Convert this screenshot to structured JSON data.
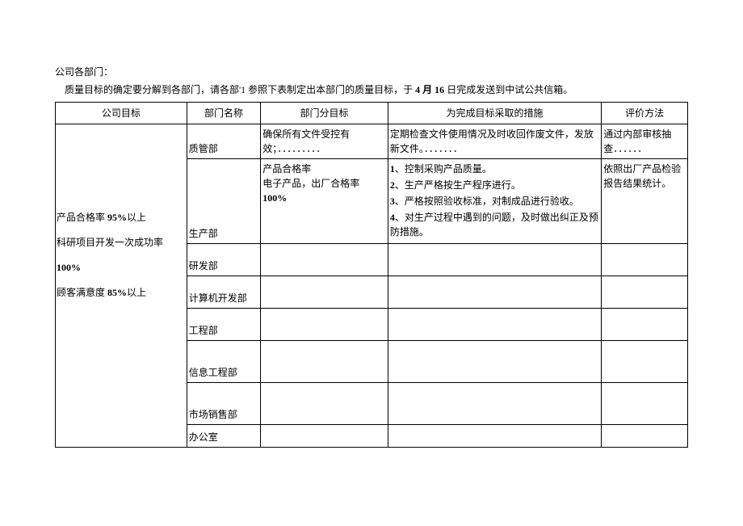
{
  "intro": {
    "line1": "公司各部门：",
    "line2_prefix": "质量目标的确定要分解到各部门，请各部'1 参照下表制定出本部门的质量目标，于 ",
    "line2_bold": "4 月 16",
    "line2_suffix": " 日完成发送到中试公共信箱。"
  },
  "headers": {
    "h1": "公司目标",
    "h2": "部门名称",
    "h3": "部门分目标",
    "h4": "为完成目标采取的措施",
    "h5": "评价方法"
  },
  "company_goals": {
    "g1_pre": "产品合格率 ",
    "g1_bold": "95%",
    "g1_post": "以上",
    "g2_pre": "科研项目开发一次成功率 ",
    "g2_bold": "100%",
    "g3_pre": "顾客满意度 ",
    "g3_bold": "85%",
    "g3_post": "以上"
  },
  "rows": {
    "r1": {
      "dept": "质管部",
      "sub": "确保所有文件受控有效；．．．．．．．．．",
      "measure": "定期检查文件使用情况及时收回作废文件，发放新文件。．．．．．．．",
      "eval": "通过内部审核抽查．．．．．．"
    },
    "r2": {
      "dept": "生产部",
      "sub_l1": "产品合格率",
      "sub_l2_pre": "电子产品，出厂合格率 ",
      "sub_l2_bold": "100%",
      "m1_pre": "1",
      "m1": "、控制采购产品质量。",
      "m2_pre": "2",
      "m2": "、生产严格按生产程序进行。",
      "m3_pre": "3",
      "m3": "、严格按照验收标准，对制成品进行验收。",
      "m4_pre": "4",
      "m4": "、对生产过程中遇到的问题，及时做出纠正及预防措施。",
      "eval": "依照出厂产品检验报告结果统计。"
    },
    "r3": {
      "dept": "研发部"
    },
    "r4": {
      "dept": "计算机开发部"
    },
    "r5": {
      "dept": "工程部"
    },
    "r6": {
      "dept": "信息工程部"
    },
    "r7": {
      "dept": "市场销售部"
    },
    "r8": {
      "dept": "办公室"
    }
  }
}
